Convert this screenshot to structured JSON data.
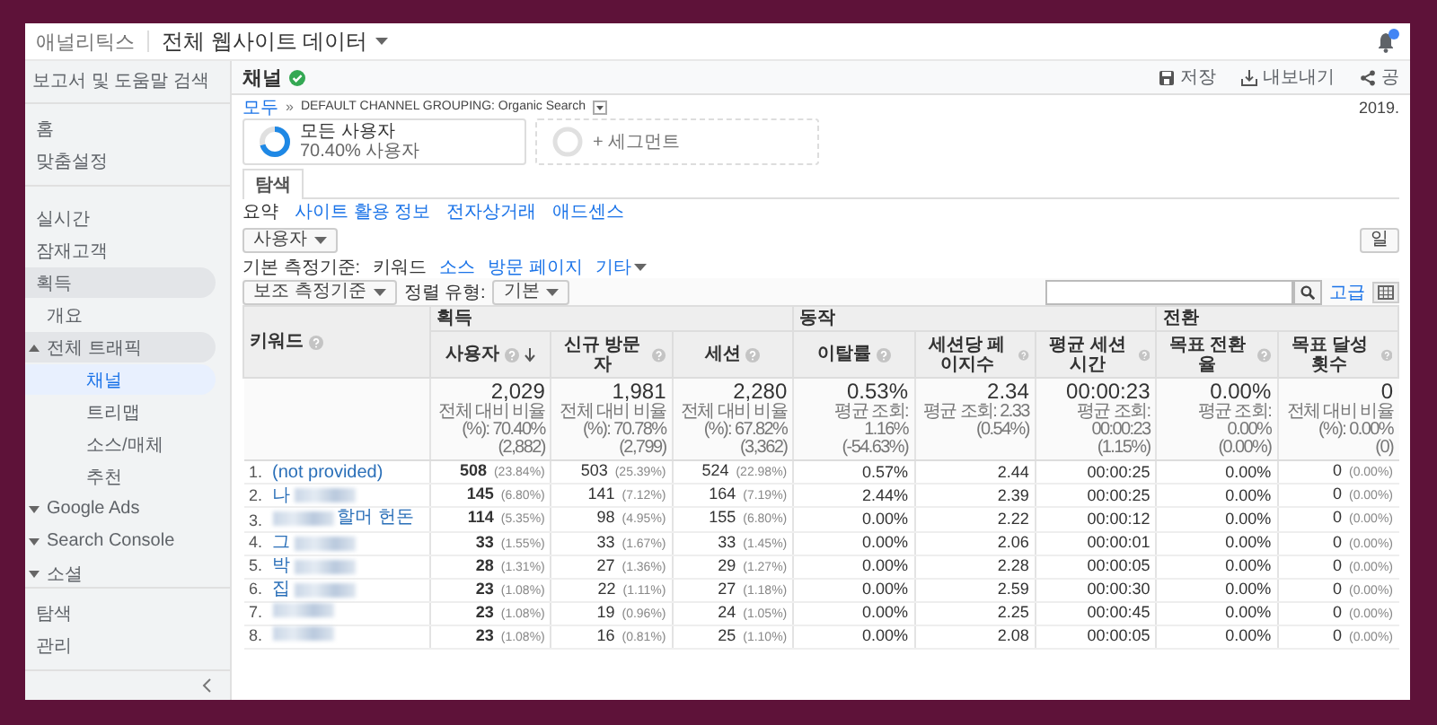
{
  "header": {
    "logo": "애널리틱스",
    "property": "전체 웹사이트 데이터"
  },
  "sidebar": {
    "search_placeholder": "보고서 및 도움말 검색",
    "sections": [
      {
        "items": [
          {
            "label": "홈",
            "selected": false
          },
          {
            "label": "맞춤설정",
            "selected": false
          }
        ]
      },
      {
        "items": [
          {
            "label": "실시간",
            "selected": false
          },
          {
            "label": "잠재고객",
            "selected": false
          },
          {
            "label": "획득",
            "selected": false,
            "expanded": true,
            "children": [
              {
                "label": "개요",
                "selected": false
              },
              {
                "label": "전체 트래픽",
                "selected": false,
                "expanded": true,
                "children": [
                  {
                    "label": "채널",
                    "selected": true
                  },
                  {
                    "label": "트리맵",
                    "selected": false
                  },
                  {
                    "label": "소스/매체",
                    "selected": false
                  },
                  {
                    "label": "추천",
                    "selected": false
                  }
                ]
              },
              {
                "label": "Google Ads",
                "selected": false,
                "expanded": false
              },
              {
                "label": "Search Console",
                "selected": false,
                "expanded": false
              },
              {
                "label": "소셜",
                "selected": false,
                "expanded": false
              }
            ]
          }
        ]
      },
      {
        "items": [
          {
            "label": "탐색",
            "selected": false
          },
          {
            "label": "관리",
            "selected": false
          }
        ]
      }
    ]
  },
  "report": {
    "title": "채널",
    "verified": true,
    "actions": [
      {
        "kind": "save",
        "label": "저장"
      },
      {
        "kind": "export",
        "label": "내보내기"
      },
      {
        "kind": "share",
        "label": "공"
      }
    ],
    "breadcrumb": {
      "separator": "»",
      "items": [
        {
          "kind": "link",
          "label": "모두"
        },
        {
          "kind": "current",
          "label": "DEFAULT CHANNEL GROUPING: Organic Search"
        }
      ]
    },
    "date": "2019.",
    "segments": [
      {
        "kind": "segment",
        "title": "모든 사용자",
        "subtitle": "70.40% 사용자",
        "level": 0.704
      },
      {
        "kind": "add",
        "title": "+ 세그먼트"
      }
    ],
    "tabs": [
      {
        "label": "탐색",
        "selected": true
      }
    ],
    "subtabs": [
      {
        "label": "요약",
        "selected": true
      },
      {
        "label": "사이트 활용 정보",
        "selected": false
      },
      {
        "label": "전자상거래",
        "selected": false
      },
      {
        "label": "애드센스",
        "selected": false
      }
    ],
    "metric_select": "사용자",
    "view_button": "일",
    "primary_dimension": {
      "label": "기본 측정기준:",
      "options": [
        {
          "kind": "option",
          "label": "키워드",
          "selected": true
        },
        {
          "kind": "option",
          "label": "소스",
          "selected": false
        },
        {
          "kind": "option",
          "label": "방문 페이지",
          "selected": false
        },
        {
          "kind": "menu",
          "label": "기타",
          "selected": false
        }
      ]
    },
    "secondary_dimension": "보조 측정기준",
    "sort_label": "정렬 유형:",
    "sort_value": "기본",
    "advanced_link": "고급",
    "table": {
      "key_column": "키워드",
      "column_groups": [
        {
          "label": "획득",
          "columns": [
            {
              "label": "사용자",
              "sorted": true
            },
            {
              "label": "신규 방문자",
              "sorted": false
            },
            {
              "label": "세션",
              "sorted": false
            }
          ]
        },
        {
          "label": "동작",
          "columns": [
            {
              "label": "이탈률",
              "sorted": false
            },
            {
              "label": "세션당 페이지수",
              "sorted": false
            },
            {
              "label": "평균 세션 시간",
              "sorted": false
            }
          ]
        },
        {
          "label": "전환",
          "columns": [
            {
              "label": "목표 전환율",
              "sorted": false
            },
            {
              "label": "목표 달성 횟수",
              "sorted": false
            }
          ]
        }
      ],
      "totals": [
        {
          "value": "2,029",
          "note": "전체 대비 비율(%): 70.40%",
          "base": "(2,882)"
        },
        {
          "value": "1,981",
          "note": "전체 대비 비율(%): 70.78%",
          "base": "(2,799)"
        },
        {
          "value": "2,280",
          "note": "전체 대비 비율(%): 67.82%",
          "base": "(3,362)"
        },
        {
          "value": "0.53%",
          "note": "평균 조회: 1.16%",
          "base": "(-54.63%)"
        },
        {
          "value": "2.34",
          "note": "평균 조회: 2.33",
          "base": "(0.54%)"
        },
        {
          "value": "00:00:23",
          "note": "평균 조회: 00:00:23",
          "base": "(1.15%)"
        },
        {
          "value": "0.00%",
          "note": "평균 조회: 0.00%",
          "base": "(0.00%)"
        },
        {
          "value": "0",
          "note": "전체 대비 비율(%): 0.00%",
          "base": "(0)"
        }
      ],
      "rows": [
        {
          "rank": "1.",
          "keyword": [
            {
              "kind": "text",
              "text": "(not provided)"
            }
          ],
          "cells": [
            {
              "value": "508",
              "share": "(23.84%)"
            },
            {
              "value": "503",
              "share": "(25.39%)"
            },
            {
              "value": "524",
              "share": "(22.98%)"
            },
            {
              "value": "0.57%"
            },
            {
              "value": "2.44"
            },
            {
              "value": "00:00:25"
            },
            {
              "value": "0.00%"
            },
            {
              "value": "0",
              "share": "(0.00%)"
            }
          ]
        },
        {
          "rank": "2.",
          "keyword": [
            {
              "kind": "text",
              "text": "나"
            },
            {
              "kind": "blur"
            }
          ],
          "cells": [
            {
              "value": "145",
              "share": "(6.80%)"
            },
            {
              "value": "141",
              "share": "(7.12%)"
            },
            {
              "value": "164",
              "share": "(7.19%)"
            },
            {
              "value": "2.44%"
            },
            {
              "value": "2.39"
            },
            {
              "value": "00:00:25"
            },
            {
              "value": "0.00%"
            },
            {
              "value": "0",
              "share": "(0.00%)"
            }
          ]
        },
        {
          "rank": "3.",
          "keyword": [
            {
              "kind": "blur"
            },
            {
              "kind": "text",
              "text": "할머 헌돈"
            }
          ],
          "cells": [
            {
              "value": "114",
              "share": "(5.35%)"
            },
            {
              "value": "98",
              "share": "(4.95%)"
            },
            {
              "value": "155",
              "share": "(6.80%)"
            },
            {
              "value": "0.00%"
            },
            {
              "value": "2.22"
            },
            {
              "value": "00:00:12"
            },
            {
              "value": "0.00%"
            },
            {
              "value": "0",
              "share": "(0.00%)"
            }
          ]
        },
        {
          "rank": "4.",
          "keyword": [
            {
              "kind": "text",
              "text": "그"
            },
            {
              "kind": "blur"
            }
          ],
          "cells": [
            {
              "value": "33",
              "share": "(1.55%)"
            },
            {
              "value": "33",
              "share": "(1.67%)"
            },
            {
              "value": "33",
              "share": "(1.45%)"
            },
            {
              "value": "0.00%"
            },
            {
              "value": "2.06"
            },
            {
              "value": "00:00:01"
            },
            {
              "value": "0.00%"
            },
            {
              "value": "0",
              "share": "(0.00%)"
            }
          ]
        },
        {
          "rank": "5.",
          "keyword": [
            {
              "kind": "text",
              "text": "박"
            },
            {
              "kind": "blur"
            }
          ],
          "cells": [
            {
              "value": "28",
              "share": "(1.31%)"
            },
            {
              "value": "27",
              "share": "(1.36%)"
            },
            {
              "value": "29",
              "share": "(1.27%)"
            },
            {
              "value": "0.00%"
            },
            {
              "value": "2.28"
            },
            {
              "value": "00:00:05"
            },
            {
              "value": "0.00%"
            },
            {
              "value": "0",
              "share": "(0.00%)"
            }
          ]
        },
        {
          "rank": "6.",
          "keyword": [
            {
              "kind": "text",
              "text": "집"
            },
            {
              "kind": "blur"
            }
          ],
          "cells": [
            {
              "value": "23",
              "share": "(1.08%)"
            },
            {
              "value": "22",
              "share": "(1.11%)"
            },
            {
              "value": "27",
              "share": "(1.18%)"
            },
            {
              "value": "0.00%"
            },
            {
              "value": "2.59"
            },
            {
              "value": "00:00:30"
            },
            {
              "value": "0.00%"
            },
            {
              "value": "0",
              "share": "(0.00%)"
            }
          ]
        },
        {
          "rank": "7.",
          "keyword": [
            {
              "kind": "blur"
            }
          ],
          "cells": [
            {
              "value": "23",
              "share": "(1.08%)"
            },
            {
              "value": "19",
              "share": "(0.96%)"
            },
            {
              "value": "24",
              "share": "(1.05%)"
            },
            {
              "value": "0.00%"
            },
            {
              "value": "2.25"
            },
            {
              "value": "00:00:45"
            },
            {
              "value": "0.00%"
            },
            {
              "value": "0",
              "share": "(0.00%)"
            }
          ]
        },
        {
          "rank": "8.",
          "keyword": [
            {
              "kind": "blur"
            }
          ],
          "cells": [
            {
              "value": "23",
              "share": "(1.08%)"
            },
            {
              "value": "16",
              "share": "(0.81%)"
            },
            {
              "value": "25",
              "share": "(1.10%)"
            },
            {
              "value": "0.00%"
            },
            {
              "value": "2.08"
            },
            {
              "value": "00:00:05"
            },
            {
              "value": "0.00%"
            },
            {
              "value": "0",
              "share": "(0.00%)"
            }
          ]
        }
      ]
    }
  }
}
